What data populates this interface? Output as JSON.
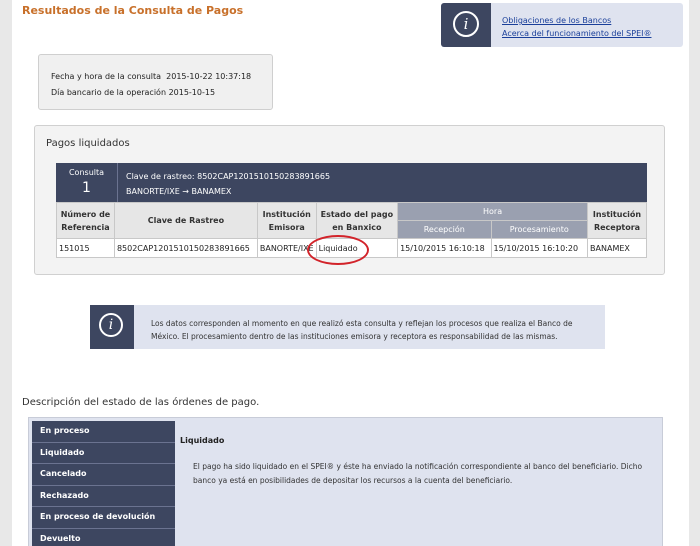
{
  "page": {
    "title": "Resultados de la Consulta de Pagos"
  },
  "info_links": [
    {
      "label": "Obligaciones de los Bancos"
    },
    {
      "label": "Acerca del funcionamiento del SPEI®"
    }
  ],
  "query": {
    "date_label": "Fecha y hora de la consulta",
    "date_value": "2015-10-22 10:37:18",
    "bank_day_label": "Día bancario de la operación",
    "bank_day_value": "2015-10-15"
  },
  "pagos": {
    "section_title": "Pagos liquidados",
    "consulta_label": "Consulta",
    "consulta_number": "1",
    "clave_line": "Clave de rastreo: 8502CAP1201510150283891665",
    "route_line": "BANORTE/IXE → BANAMEX",
    "headers": {
      "ref": "Número de Referencia",
      "clave": "Clave de Rastreo",
      "emisora": "Institución Emisora",
      "estado": "Estado del pago en Banxico",
      "hora": "Hora",
      "recepcion": "Recepción",
      "procesamiento": "Procesamiento",
      "receptora": "Institución Receptora"
    },
    "row": {
      "ref": "151015",
      "clave": "8502CAP1201510150283891665",
      "emisora": "BANORTE/IXE",
      "estado": "Liquidado",
      "recepcion": "15/10/2015 16:10:18",
      "procesamiento": "15/10/2015 16:10:20",
      "receptora": "BANAMEX"
    }
  },
  "note": {
    "text": "Los datos corresponden al momento en que realizó esta consulta y reflejan los procesos que realiza el Banco de México. El procesamiento dentro de las instituciones emisora y receptora es responsabilidad de las mismas."
  },
  "description": {
    "title": "Descripción del estado de las órdenes de pago.",
    "items": [
      {
        "label": "En proceso"
      },
      {
        "label": "Liquidado"
      },
      {
        "label": "Cancelado"
      },
      {
        "label": "Rechazado"
      },
      {
        "label": "En proceso de devolución"
      },
      {
        "label": "Devuelto"
      }
    ],
    "detail_title": "Liquidado",
    "detail_text": "El pago ha sido liquidado en el SPEI® y éste ha enviado la notificación correspondiente al banco del beneficiario. Dicho banco ya está en posibilidades de depositar los recursos a la cuenta del beneficiario."
  },
  "icons": {
    "info": "info-icon",
    "info_glyph": "i"
  },
  "colors": {
    "title": "#c8702a",
    "navy": "#3d4660",
    "panel": "#dfe3ef",
    "link": "#1a3f9a",
    "highlight": "#d2232a"
  }
}
